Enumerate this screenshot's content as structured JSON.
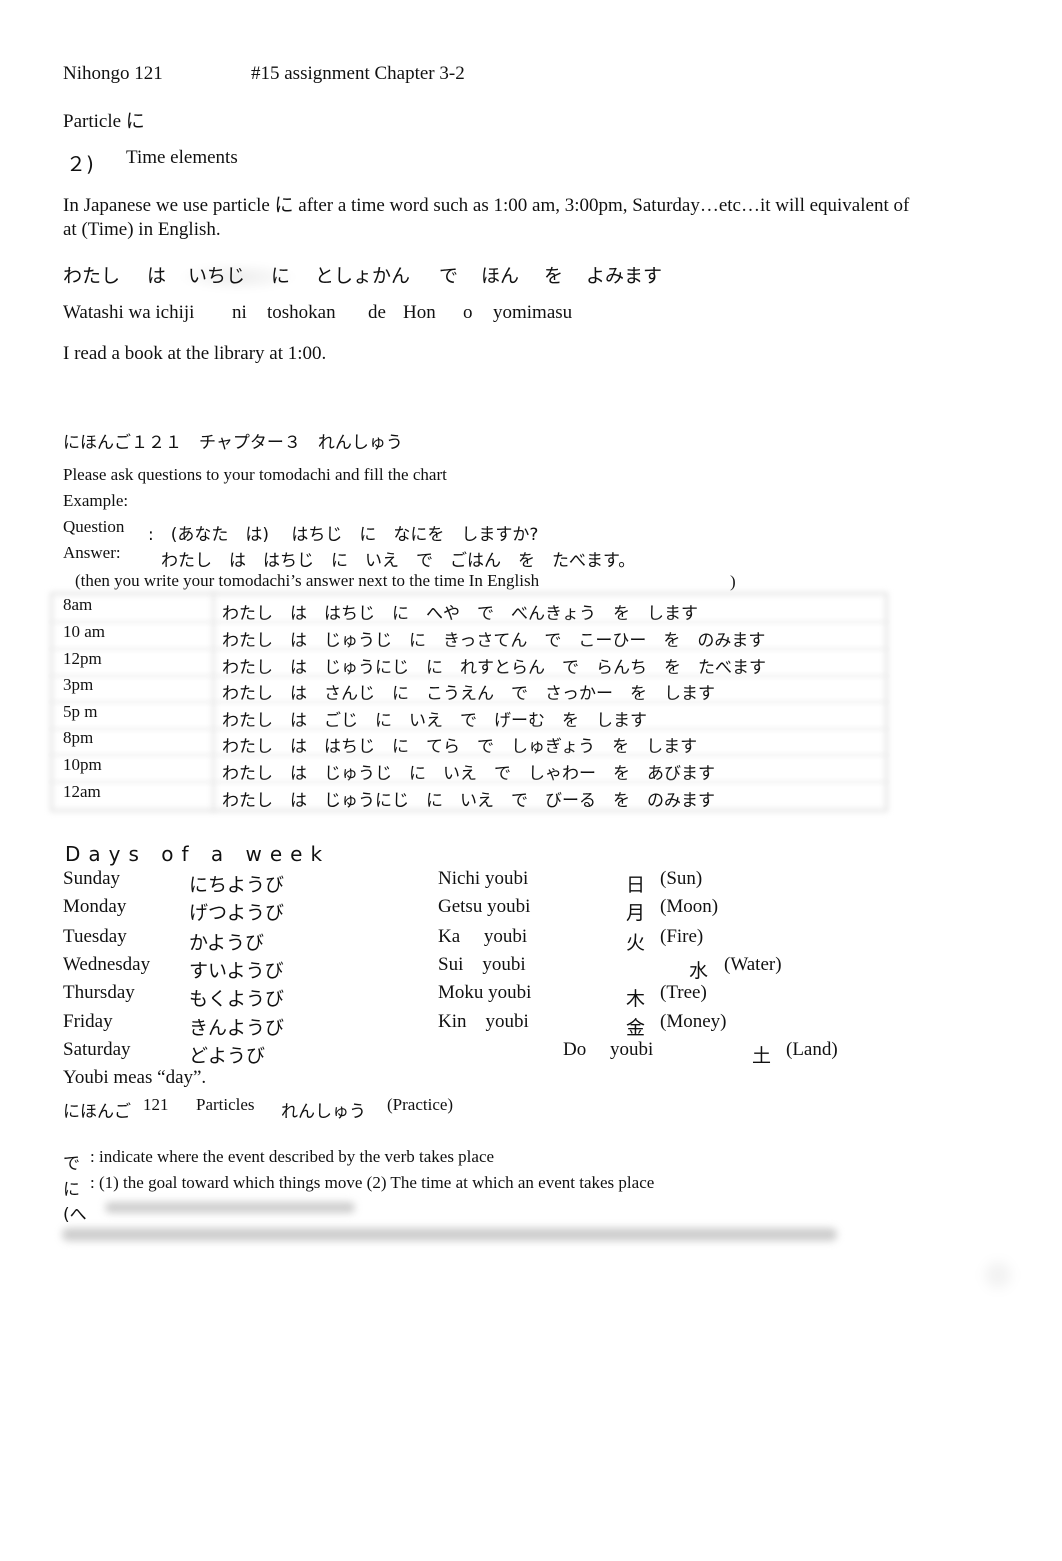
{
  "header": {
    "course": "Nihongo 121",
    "assignment": "#15 assignment Chapter 3-2"
  },
  "particle_title": "Particle に",
  "section": {
    "number": "２)",
    "title": "Time elements"
  },
  "intro": {
    "line1": "In Japanese we use particle に after a time word such as 1:00 am, 3:00pm, Saturday…etc…it will equivalent of",
    "line2": "at (Time) in English."
  },
  "example": {
    "japanese": [
      "わたし",
      "は",
      "いちじ",
      "に",
      "としょかん",
      "で",
      "ほん",
      "を",
      "よみます"
    ],
    "romaji": [
      "Watashi wa ichiji",
      "ni",
      "toshokan",
      "de",
      "Hon",
      "o",
      "yomimasu"
    ],
    "english": "I read a book at the library at 1:00."
  },
  "practice": {
    "heading": "にほんご１２１　チャプター３　れんしゅう",
    "instruction": "Please ask questions to your tomodachi and fill the chart",
    "example_label": "Example:",
    "question_label": "Question",
    "question_text": ":　(あなた　は)　 はちじ　に　なにを　しますか?",
    "answer_label": "Answer:",
    "answer_text": "わたし　は　はちじ　に　いえ　で　ごはん　を　たべます。",
    "note": "(then you write your tomodachi’s answer next to the time In English",
    "note_close": ")"
  },
  "schedule": [
    {
      "time": "8am",
      "answer": "わたし　は　はちじ　に　へや　で　べんきょう　を　します"
    },
    {
      "time": "10 am",
      "answer": "わたし　は　じゅうじ　に　きっさてん　で　こーひー　を　のみます"
    },
    {
      "time": "12pm",
      "answer": "わたし　は　じゅうにじ　に　れすとらん　で　らんち　を　たべます"
    },
    {
      "time": "3pm",
      "answer": "わたし　は　さんじ　に　こうえん　で　さっかー　を　します"
    },
    {
      "time": "5p m",
      "answer": "わたし　は　ごじ　に　いえ　で　げーむ　を　します"
    },
    {
      "time": "8pm",
      "answer": "わたし　は　はちじ　に　てら　で　しゅぎょう　を　します"
    },
    {
      "time": "10pm",
      "answer": "わたし　は　じゅうじ　に　いえ　で　しゃわー　を　あびます"
    },
    {
      "time": "12am",
      "answer": "わたし　は　じゅうにじ　に　いえ　で　びーる　を　のみます"
    }
  ],
  "days": {
    "title": "Days of a week",
    "items": [
      {
        "english": "Sunday",
        "kana": "にちようび",
        "romaji": "Nichi youbi",
        "kanji": "日",
        "meaning": "(Sun)"
      },
      {
        "english": "Monday",
        "kana": "げつようび",
        "romaji": "Getsu youbi",
        "kanji": "月",
        "meaning": "(Moon)"
      },
      {
        "english": "Tuesday",
        "kana": "かようび",
        "romaji": "Ka     youbi",
        "kanji": "火",
        "meaning": "(Fire)"
      },
      {
        "english": "Wednesday",
        "kana": "すいようび",
        "romaji": "Sui    youbi",
        "kanji": "水",
        "meaning": "(Water)"
      },
      {
        "english": "Thursday",
        "kana": "もくようび",
        "romaji": "Moku youbi",
        "kanji": "木",
        "meaning": "(Tree)"
      },
      {
        "english": "Friday",
        "kana": "きんようび",
        "romaji": "Kin    youbi",
        "kanji": "金",
        "meaning": "(Money)"
      },
      {
        "english": "Saturday",
        "kana": "どようび",
        "romaji": "Do     youbi",
        "kanji": "土",
        "meaning": "(Land)"
      }
    ],
    "note": "Youbi meas “day”."
  },
  "particles": {
    "heading_jp": "にほんご",
    "heading_num": "121",
    "heading_word": "Particles",
    "heading_renshu": "れんしゅう",
    "heading_practice": "(Practice)",
    "de_mark": "で",
    "de_text": ": indicate where the event described by the verb takes place",
    "ni_mark": "に",
    "ni_text": ": (1) the goal toward which things move (2) The time at which an event takes place",
    "he_mark": "(へ"
  }
}
